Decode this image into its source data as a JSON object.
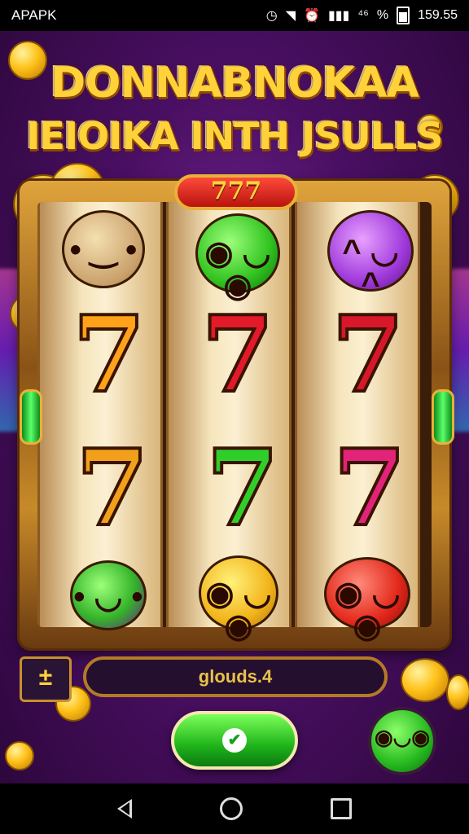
{
  "status_bar": {
    "app_label": "APAPK",
    "time": "159.55",
    "signal_text": "⁴⁶",
    "percent_text": "%"
  },
  "game": {
    "title_line1": "DONNABNOKAA",
    "title_line2": "IEIOIKA INTH JSULLS",
    "banner_text": "777",
    "bet_symbol": "±",
    "info_text": "ɡlouds.4",
    "spin_symbol": "✔"
  },
  "reels": [
    [
      "creature-tan",
      "seven-orange",
      "seven-gold",
      "creature-green"
    ],
    [
      "creature-green",
      "seven-red",
      "seven-green",
      "creature-yellow"
    ],
    [
      "creature-purple",
      "seven-red",
      "seven-pink",
      "creature-red"
    ]
  ],
  "colors": {
    "background": "#4a0f63",
    "frame_gold": "#c78a2a",
    "title_gold": "#ffd23a",
    "spin_green": "#1fb41a",
    "seven_orange": "#ffa21a",
    "seven_red": "#e21a2a",
    "seven_green": "#2fcf2a",
    "seven_pink": "#e2237a"
  }
}
